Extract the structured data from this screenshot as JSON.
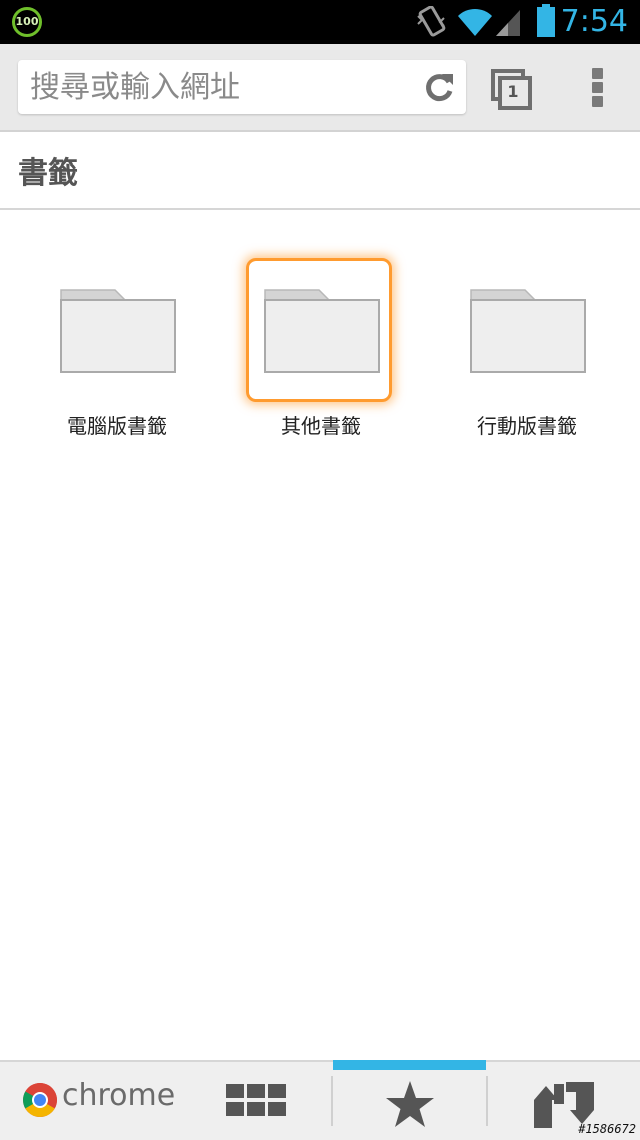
{
  "status_bar": {
    "battery_level": "100",
    "time": "7:54",
    "icons": [
      "battery-circle-icon",
      "vibrate-icon",
      "wifi-icon",
      "signal-icon",
      "battery-icon"
    ]
  },
  "toolbar": {
    "omnibox_placeholder": "搜尋或輸入網址",
    "tab_count": "1"
  },
  "bookmarks": {
    "title": "書籤",
    "folders": [
      {
        "label": "電腦版書籤",
        "selected": false
      },
      {
        "label": "其他書籤",
        "selected": true
      },
      {
        "label": "行動版書籤",
        "selected": false
      }
    ]
  },
  "bottom_bar": {
    "brand": "chrome"
  },
  "watermark": "#1586672",
  "colors": {
    "accent": "#33b5e5",
    "focus": "#ff9b2f",
    "status_bar_bg": "#000000",
    "toolbar_bg": "#e9e9e9"
  }
}
